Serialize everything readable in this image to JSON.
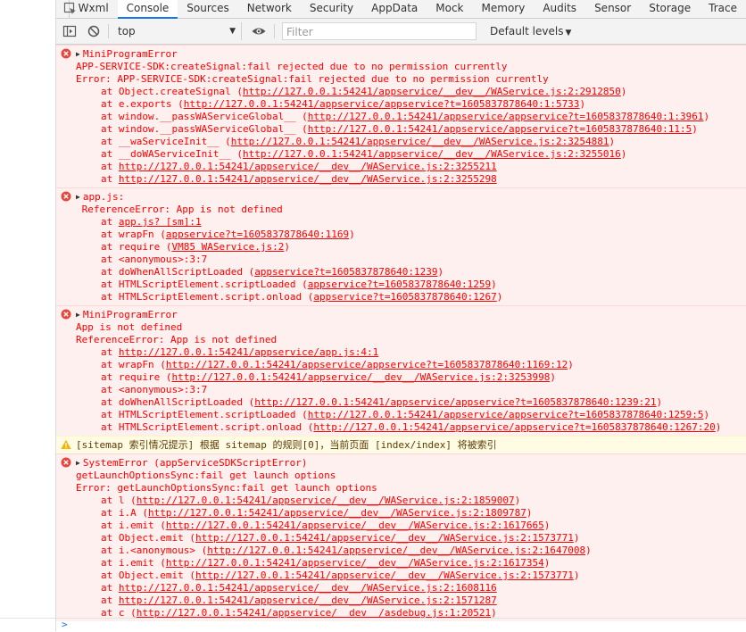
{
  "tabs": [
    {
      "label": "Wxml",
      "active": false
    },
    {
      "label": "Console",
      "active": true
    },
    {
      "label": "Sources",
      "active": false
    },
    {
      "label": "Network",
      "active": false
    },
    {
      "label": "Security",
      "active": false
    },
    {
      "label": "AppData",
      "active": false
    },
    {
      "label": "Mock",
      "active": false
    },
    {
      "label": "Memory",
      "active": false
    },
    {
      "label": "Audits",
      "active": false
    },
    {
      "label": "Sensor",
      "active": false
    },
    {
      "label": "Storage",
      "active": false
    },
    {
      "label": "Trace",
      "active": false
    }
  ],
  "toolbar": {
    "context": "top",
    "filter_placeholder": "Filter",
    "levels": "Default levels",
    "icons": [
      "toggle-sidebar-icon",
      "clear-console-icon",
      "dropdown-arrow-icon",
      "eye-icon"
    ]
  },
  "colors": {
    "error_text": "#ff0000",
    "error_bg": "#fff0f0",
    "warning_bg": "#fffbe5",
    "accent": "#1a73e8"
  },
  "messages": [
    {
      "level": "error",
      "title": "MiniProgramError",
      "lines": [
        "APP-SERVICE-SDK:createSignal:fail rejected due to no permission currently",
        "Error: APP-SERVICE-SDK:createSignal:fail rejected due to no permission currently"
      ],
      "frames": [
        {
          "prefix": "at Object.createSignal (",
          "link": "http://127.0.0.1:54241/appservice/__dev__/WAService.js:2:2912850",
          "suffix": ")"
        },
        {
          "prefix": "at e.exports (",
          "link": "http://127.0.0.1:54241/appservice/appservice?t=1605837878640:1:5733",
          "suffix": ")"
        },
        {
          "prefix": "at window.__passWAServiceGlobal__ (",
          "link": "http://127.0.0.1:54241/appservice/appservice?t=1605837878640:1:3961",
          "suffix": ")"
        },
        {
          "prefix": "at window.__passWAServiceGlobal__ (",
          "link": "http://127.0.0.1:54241/appservice/appservice?t=1605837878640:11:5",
          "suffix": ")"
        },
        {
          "prefix": "at __waServiceInit__ (",
          "link": "http://127.0.0.1:54241/appservice/__dev__/WAService.js:2:3254881",
          "suffix": ")"
        },
        {
          "prefix": "at __doWAServiceInit__ (",
          "link": "http://127.0.0.1:54241/appservice/__dev__/WAService.js:2:3255016",
          "suffix": ")"
        },
        {
          "prefix": "at ",
          "link": "http://127.0.0.1:54241/appservice/__dev__/WAService.js:2:3255211",
          "suffix": ""
        },
        {
          "prefix": "at ",
          "link": "http://127.0.0.1:54241/appservice/__dev__/WAService.js:2:3255298",
          "suffix": ""
        }
      ]
    },
    {
      "level": "error",
      "title": "app.js:",
      "lines": [
        " ReferenceError: App is not defined"
      ],
      "frames": [
        {
          "prefix": "at ",
          "link": "app.js? [sm]:1",
          "suffix": ""
        },
        {
          "prefix": "at wrapFn (",
          "link": "appservice?t=1605837878640:1169",
          "suffix": ")"
        },
        {
          "prefix": "at require (",
          "link": "VM85 WAService.js:2",
          "suffix": ")"
        },
        {
          "prefix": "at <anonymous>:3:7",
          "link": "",
          "suffix": ""
        },
        {
          "prefix": "at doWhenAllScriptLoaded (",
          "link": "appservice?t=1605837878640:1239",
          "suffix": ")"
        },
        {
          "prefix": "at HTMLScriptElement.scriptLoaded (",
          "link": "appservice?t=1605837878640:1259",
          "suffix": ")"
        },
        {
          "prefix": "at HTMLScriptElement.script.onload (",
          "link": "appservice?t=1605837878640:1267",
          "suffix": ")"
        }
      ]
    },
    {
      "level": "error",
      "title": "MiniProgramError",
      "lines": [
        "App is not defined",
        "ReferenceError: App is not defined"
      ],
      "frames": [
        {
          "prefix": "at ",
          "link": "http://127.0.0.1:54241/appservice/app.js:4:1",
          "suffix": ""
        },
        {
          "prefix": "at wrapFn (",
          "link": "http://127.0.0.1:54241/appservice/appservice?t=1605837878640:1169:12",
          "suffix": ")"
        },
        {
          "prefix": "at require (",
          "link": "http://127.0.0.1:54241/appservice/__dev__/WAService.js:2:3253998",
          "suffix": ")"
        },
        {
          "prefix": "at <anonymous>:3:7",
          "link": "",
          "suffix": ""
        },
        {
          "prefix": "at doWhenAllScriptLoaded (",
          "link": "http://127.0.0.1:54241/appservice/appservice?t=1605837878640:1239:21",
          "suffix": ")"
        },
        {
          "prefix": "at HTMLScriptElement.scriptLoaded (",
          "link": "http://127.0.0.1:54241/appservice/appservice?t=1605837878640:1259:5",
          "suffix": ")"
        },
        {
          "prefix": "at HTMLScriptElement.script.onload (",
          "link": "http://127.0.0.1:54241/appservice/appservice?t=1605837878640:1267:20",
          "suffix": ")"
        }
      ]
    },
    {
      "level": "warning",
      "title": "",
      "lines": [
        "[sitemap 索引情况提示] 根据 sitemap 的规则[0]，当前页面 [index/index] 将被索引"
      ],
      "frames": []
    },
    {
      "level": "error",
      "title": "SystemError (appServiceSDKScriptError)",
      "lines": [
        "getLaunchOptionsSync:fail get launch options",
        "Error: getLaunchOptionsSync:fail get launch options"
      ],
      "frames": [
        {
          "prefix": "at l (",
          "link": "http://127.0.0.1:54241/appservice/__dev__/WAService.js:2:1859007",
          "suffix": ")"
        },
        {
          "prefix": "at i.A (",
          "link": "http://127.0.0.1:54241/appservice/__dev__/WAService.js:2:1809787",
          "suffix": ")"
        },
        {
          "prefix": "at i.emit (",
          "link": "http://127.0.0.1:54241/appservice/__dev__/WAService.js:2:1617665",
          "suffix": ")"
        },
        {
          "prefix": "at Object.emit (",
          "link": "http://127.0.0.1:54241/appservice/__dev__/WAService.js:2:1573771",
          "suffix": ")"
        },
        {
          "prefix": "at i.<anonymous> (",
          "link": "http://127.0.0.1:54241/appservice/__dev__/WAService.js:2:1647008",
          "suffix": ")"
        },
        {
          "prefix": "at i.emit (",
          "link": "http://127.0.0.1:54241/appservice/__dev__/WAService.js:2:1617354",
          "suffix": ")"
        },
        {
          "prefix": "at Object.emit (",
          "link": "http://127.0.0.1:54241/appservice/__dev__/WAService.js:2:1573771",
          "suffix": ")"
        },
        {
          "prefix": "at ",
          "link": "http://127.0.0.1:54241/appservice/__dev__/WAService.js:2:1608116",
          "suffix": ""
        },
        {
          "prefix": "at ",
          "link": "http://127.0.0.1:54241/appservice/__dev__/WAService.js:2:1571287",
          "suffix": ""
        },
        {
          "prefix": "at c (",
          "link": "http://127.0.0.1:54241/appservice/__dev__/asdebug.js:1:20521",
          "suffix": ")"
        }
      ]
    }
  ],
  "prompt_symbol": ">"
}
